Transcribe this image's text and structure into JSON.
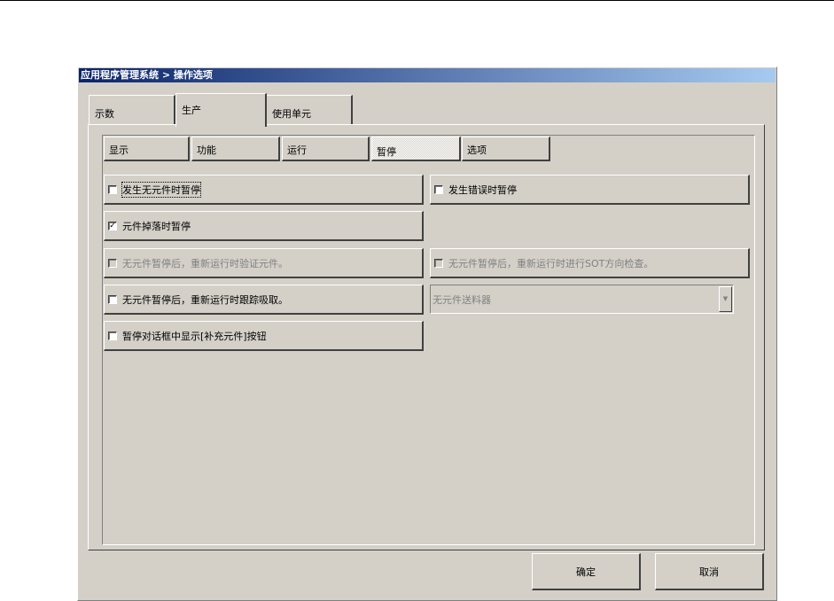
{
  "window": {
    "title": "应用程序管理系统 > 操作选项"
  },
  "outer_tabs": [
    {
      "label": "示数"
    },
    {
      "label": "生产",
      "selected": true
    },
    {
      "label": "使用单元"
    }
  ],
  "inner_tabs": [
    {
      "label": "显示"
    },
    {
      "label": "功能"
    },
    {
      "label": "运行"
    },
    {
      "label": "暂停",
      "selected": true
    },
    {
      "label": "选项"
    }
  ],
  "options": {
    "pause_no_part": {
      "label": "发生无元件时暂停",
      "checked": false
    },
    "pause_on_error": {
      "label": "发生错误时暂停",
      "checked": false
    },
    "pause_part_drop": {
      "label": "元件掉落时暂停",
      "checked": true,
      "mark": "✓"
    },
    "verify_part": {
      "label": "无元件暂停后，重新运行时验证元件。",
      "checked": false,
      "disabled": true
    },
    "sot_check": {
      "label": "无元件暂停后，重新运行时进行SOT方向检查。",
      "checked": false,
      "disabled": true
    },
    "track_pick": {
      "label": "无元件暂停后，重新运行时跟踪吸取。",
      "checked": false
    },
    "show_refill": {
      "label": "暂停对话框中显示[补充元件]按钮",
      "checked": false
    }
  },
  "feeder_combo": {
    "value": "无元件送料器",
    "arrow": "▼"
  },
  "buttons": {
    "ok": "确定",
    "cancel": "取消"
  }
}
